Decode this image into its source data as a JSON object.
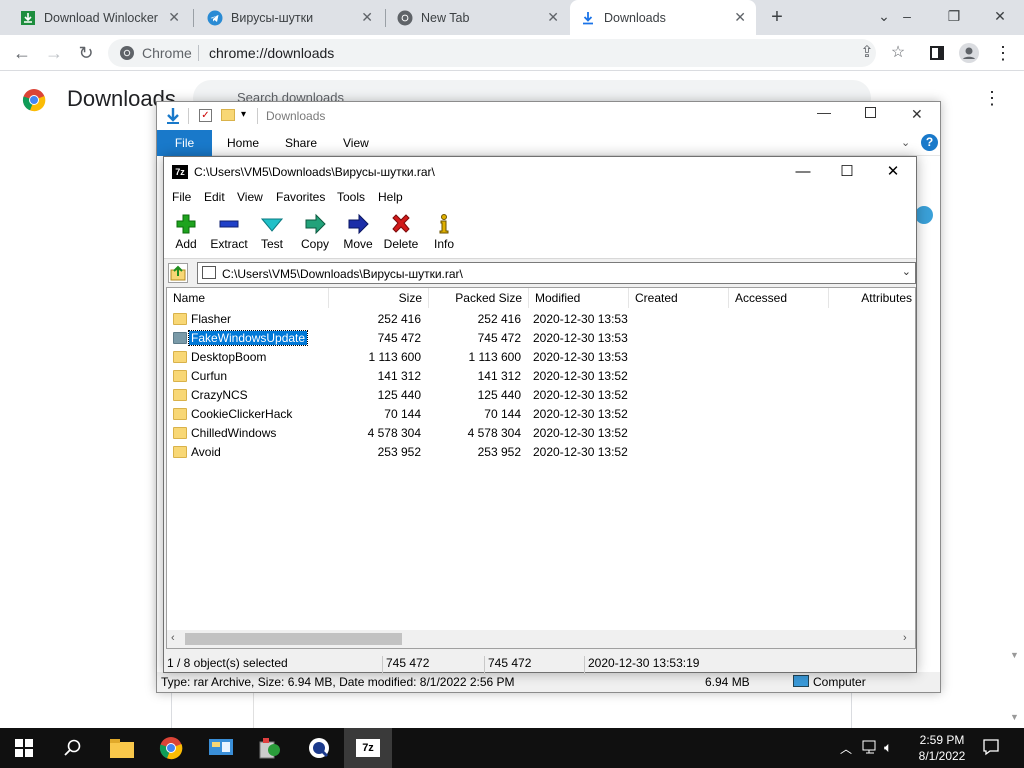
{
  "chrome": {
    "tabs": [
      {
        "label": "Download Winlocker b",
        "active": false
      },
      {
        "label": "Вирусы-шутки",
        "active": false
      },
      {
        "label": "New Tab",
        "active": false
      },
      {
        "label": "Downloads",
        "active": true
      }
    ],
    "omnibox": {
      "site": "Chrome",
      "url": "chrome://downloads"
    },
    "page_title": "Downloads",
    "search_placeholder": "Search downloads"
  },
  "explorer": {
    "title": "Downloads",
    "ribbon_tabs": [
      "File",
      "Home",
      "Share",
      "View"
    ],
    "status": {
      "info": "Type: rar Archive, Size: 6.94 MB, Date modified: 8/1/2022 2:56 PM",
      "size": "6.94 MB",
      "location": "Computer"
    }
  },
  "sevenzip": {
    "title": "C:\\Users\\VM5\\Downloads\\Вирусы-шутки.rar\\",
    "menu": [
      "File",
      "Edit",
      "View",
      "Favorites",
      "Tools",
      "Help"
    ],
    "tools": [
      "Add",
      "Extract",
      "Test",
      "Copy",
      "Move",
      "Delete",
      "Info"
    ],
    "path": "C:\\Users\\VM5\\Downloads\\Вирусы-шутки.rar\\",
    "columns": [
      "Name",
      "Size",
      "Packed Size",
      "Modified",
      "Created",
      "Accessed",
      "Attributes"
    ],
    "rows": [
      {
        "name": "Flasher",
        "size": "252 416",
        "packed": "252 416",
        "modified": "2020-12-30 13:53",
        "selected": false
      },
      {
        "name": "FakeWindowsUpdate",
        "size": "745 472",
        "packed": "745 472",
        "modified": "2020-12-30 13:53",
        "selected": true
      },
      {
        "name": "DesktopBoom",
        "size": "1 113 600",
        "packed": "1 113 600",
        "modified": "2020-12-30 13:53",
        "selected": false
      },
      {
        "name": "Curfun",
        "size": "141 312",
        "packed": "141 312",
        "modified": "2020-12-30 13:52",
        "selected": false
      },
      {
        "name": "CrazyNCS",
        "size": "125 440",
        "packed": "125 440",
        "modified": "2020-12-30 13:52",
        "selected": false
      },
      {
        "name": "CookieClickerHack",
        "size": "70 144",
        "packed": "70 144",
        "modified": "2020-12-30 13:52",
        "selected": false
      },
      {
        "name": "ChilledWindows",
        "size": "4 578 304",
        "packed": "4 578 304",
        "modified": "2020-12-30 13:52",
        "selected": false
      },
      {
        "name": "Avoid",
        "size": "253 952",
        "packed": "253 952",
        "modified": "2020-12-30 13:52",
        "selected": false
      }
    ],
    "status": {
      "selection": "1 / 8 object(s) selected",
      "size": "745 472",
      "packed": "745 472",
      "modified": "2020-12-30 13:53:19"
    }
  },
  "taskbar": {
    "time": "2:59 PM",
    "date": "8/1/2022"
  }
}
